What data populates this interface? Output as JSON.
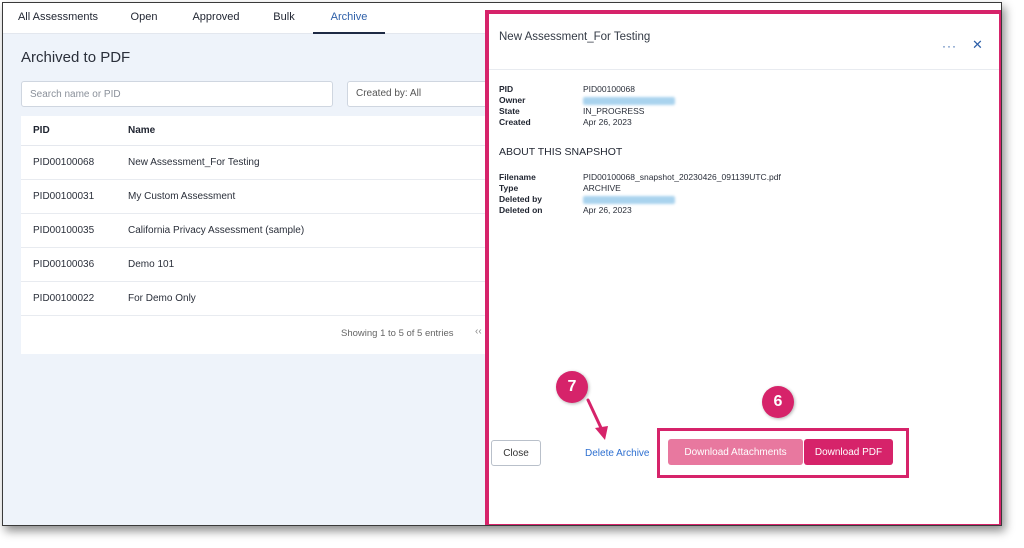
{
  "tabs": [
    {
      "label": "All Assessments"
    },
    {
      "label": "Open"
    },
    {
      "label": "Approved"
    },
    {
      "label": "Bulk"
    },
    {
      "label": "Archive",
      "active": true
    }
  ],
  "page": {
    "title": "Archived to PDF",
    "search_placeholder": "Search name or PID",
    "created_by_filter": "Created by: All"
  },
  "table": {
    "columns": [
      "PID",
      "Name"
    ],
    "rows": [
      {
        "pid": "PID00100068",
        "name": "New Assessment_For Testing"
      },
      {
        "pid": "PID00100031",
        "name": "My Custom Assessment"
      },
      {
        "pid": "PID00100035",
        "name": "California Privacy Assessment (sample)"
      },
      {
        "pid": "PID00100036",
        "name": "Demo 101"
      },
      {
        "pid": "PID00100022",
        "name": "For Demo Only"
      }
    ],
    "pagination_text": "Showing 1 to 5 of 5 entries",
    "pagination_prev": "‹‹"
  },
  "panel": {
    "title": "New Assessment_For Testing",
    "more_glyph": "···",
    "close_glyph": "✕",
    "details": [
      {
        "label": "PID",
        "value": "PID00100068"
      },
      {
        "label": "Owner",
        "value": "",
        "redacted": true
      },
      {
        "label": "State",
        "value": "IN_PROGRESS"
      },
      {
        "label": "Created",
        "value": "Apr 26, 2023"
      }
    ],
    "snapshot_title": "ABOUT THIS SNAPSHOT",
    "snapshot": [
      {
        "label": "Filename",
        "value": "PID00100068_snapshot_20230426_091139UTC.pdf"
      },
      {
        "label": "Type",
        "value": "ARCHIVE"
      },
      {
        "label": "Deleted by",
        "value": "",
        "redacted": true
      },
      {
        "label": "Deleted on",
        "value": "Apr 26, 2023"
      }
    ],
    "close_label": "Close",
    "delete_label": "Delete Archive",
    "download_attachments_label": "Download Attachments",
    "download_pdf_label": "Download PDF"
  },
  "annotations": {
    "badge_delete": "7",
    "badge_downloads": "6"
  },
  "colors": {
    "accent": "#d6236a",
    "accent_light": "#e8789f",
    "link": "#2d6fd0",
    "tab_active": "#2d5fa8",
    "page_bg": "#eef3fa"
  },
  "icons": [
    "more-options-icon",
    "close-icon",
    "arrow-icon"
  ]
}
